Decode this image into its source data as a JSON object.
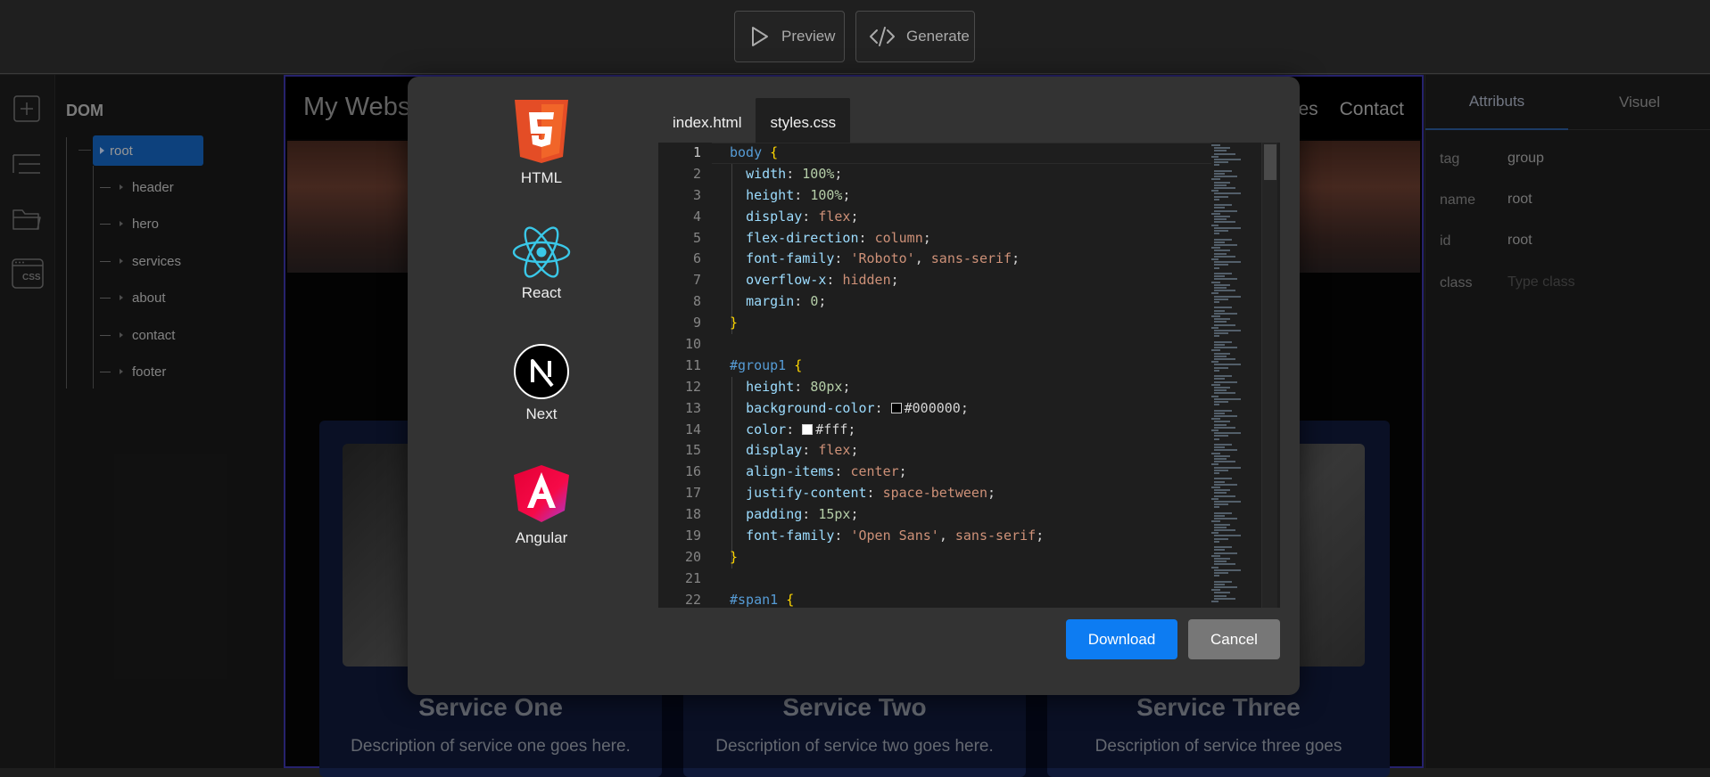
{
  "toolbar": {
    "preview_label": "Preview",
    "generate_label": "Generate"
  },
  "rail": {
    "icons": [
      "plus-icon",
      "tree-icon",
      "folder-icon",
      "css-icon"
    ],
    "css_badge": "CSS"
  },
  "dom_panel": {
    "title": "DOM",
    "root": "root",
    "children": [
      "header",
      "hero",
      "services",
      "about",
      "contact",
      "footer"
    ]
  },
  "canvas": {
    "site_title": "My Website",
    "nav": [
      "Services",
      "Contact"
    ],
    "services": [
      {
        "title": "Service One",
        "desc": "Description of service one goes here."
      },
      {
        "title": "Service Two",
        "desc": "Description of service two goes here."
      },
      {
        "title": "Service Three",
        "desc": "Description of service three goes"
      }
    ]
  },
  "right_panel": {
    "tabs": [
      "Attributs",
      "Visuel"
    ],
    "attributes": [
      {
        "key": "tag",
        "value": "group"
      },
      {
        "key": "name",
        "value": "root"
      },
      {
        "key": "id",
        "value": "root"
      },
      {
        "key": "class",
        "value": ""
      }
    ],
    "class_placeholder": "Type class"
  },
  "modal": {
    "frameworks": [
      {
        "name": "HTML",
        "icon": "html5-icon"
      },
      {
        "name": "React",
        "icon": "react-icon"
      },
      {
        "name": "Next",
        "icon": "nextjs-icon"
      },
      {
        "name": "Angular",
        "icon": "angular-icon"
      }
    ],
    "tabs": [
      "index.html",
      "styles.css"
    ],
    "active_tab": "styles.css",
    "code_lines": [
      {
        "n": "1",
        "t": "body {"
      },
      {
        "n": "2",
        "t": "  width: 100%;"
      },
      {
        "n": "3",
        "t": "  height: 100%;"
      },
      {
        "n": "4",
        "t": "  display: flex;"
      },
      {
        "n": "5",
        "t": "  flex-direction: column;"
      },
      {
        "n": "6",
        "t": "  font-family: 'Roboto', sans-serif;"
      },
      {
        "n": "7",
        "t": "  overflow-x: hidden;"
      },
      {
        "n": "8",
        "t": "  margin: 0;"
      },
      {
        "n": "9",
        "t": "}"
      },
      {
        "n": "10",
        "t": ""
      },
      {
        "n": "11",
        "t": "#group1 {"
      },
      {
        "n": "12",
        "t": "  height: 80px;"
      },
      {
        "n": "13",
        "t": "  background-color: #000000;"
      },
      {
        "n": "14",
        "t": "  color: #fff;"
      },
      {
        "n": "15",
        "t": "  display: flex;"
      },
      {
        "n": "16",
        "t": "  align-items: center;"
      },
      {
        "n": "17",
        "t": "  justify-content: space-between;"
      },
      {
        "n": "18",
        "t": "  padding: 15px;"
      },
      {
        "n": "19",
        "t": "  font-family: 'Open Sans', sans-serif;"
      },
      {
        "n": "20",
        "t": "}"
      },
      {
        "n": "21",
        "t": ""
      },
      {
        "n": "22",
        "t": "#span1 {"
      }
    ],
    "download_label": "Download",
    "cancel_label": "Cancel"
  },
  "colors": {
    "accent": "#0d7cf2",
    "selected_node": "#1565c0",
    "canvas_border": "#3b35a8",
    "modal_bg": "#333333",
    "editor_bg": "#1e1e1e"
  }
}
